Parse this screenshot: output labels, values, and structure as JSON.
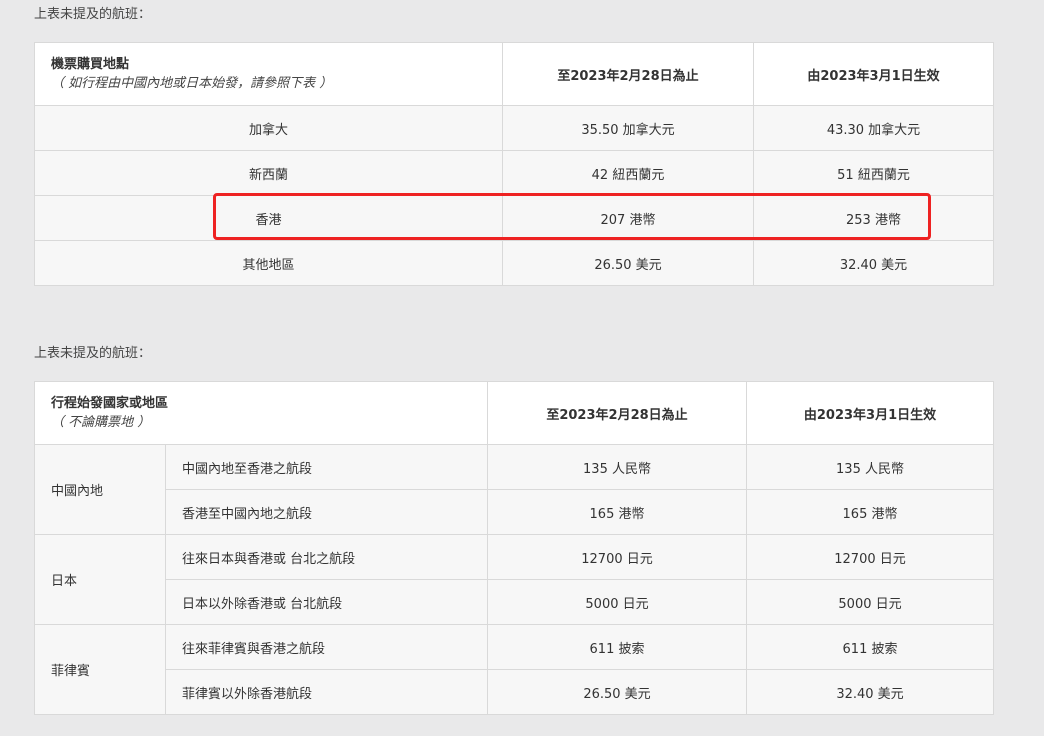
{
  "section1": {
    "caption": "上表未提及的航班：",
    "header": {
      "col1_title": "機票購買地點",
      "col1_sub": "（ 如行程由中國內地或日本始發，請參照下表 ）",
      "col2": "至2023年2月28日為止",
      "col3": "由2023年3月1日生效"
    },
    "rows": [
      {
        "place": "加拿大",
        "before": "35.50 加拿大元",
        "after": "43.30 加拿大元"
      },
      {
        "place": "新西蘭",
        "before": "42 紐西蘭元",
        "after": "51 紐西蘭元"
      },
      {
        "place": "香港",
        "before": "207 港幣",
        "after": "253 港幣"
      },
      {
        "place": "其他地區",
        "before": "26.50 美元",
        "after": "32.40 美元"
      }
    ],
    "highlight_color": "#ee2222"
  },
  "section2": {
    "caption": "上表未提及的航班：",
    "header": {
      "col1_title": "行程始發國家或地區",
      "col1_sub": "（ 不論購票地 ）",
      "col2": "至2023年2月28日為止",
      "col3": "由2023年3月1日生效"
    },
    "groups": [
      {
        "region": "中國內地",
        "rows": [
          {
            "segment": "中國內地至香港之航段",
            "before": "135 人民幣",
            "after": "135 人民幣"
          },
          {
            "segment": "香港至中國內地之航段",
            "before": "165 港幣",
            "after": "165 港幣"
          }
        ]
      },
      {
        "region": "日本",
        "rows": [
          {
            "segment": "往來日本與香港或 台北之航段",
            "before": "12700 日元",
            "after": "12700 日元"
          },
          {
            "segment": "日本以外除香港或 台北航段",
            "before": "5000 日元",
            "after": "5000 日元"
          }
        ]
      },
      {
        "region": "菲律賓",
        "rows": [
          {
            "segment": "往來菲律賓與香港之航段",
            "before": "611 披索",
            "after": "611 披索"
          },
          {
            "segment": "菲律賓以外除香港航段",
            "before": "26.50 美元",
            "after": "32.40 美元"
          }
        ]
      }
    ]
  }
}
